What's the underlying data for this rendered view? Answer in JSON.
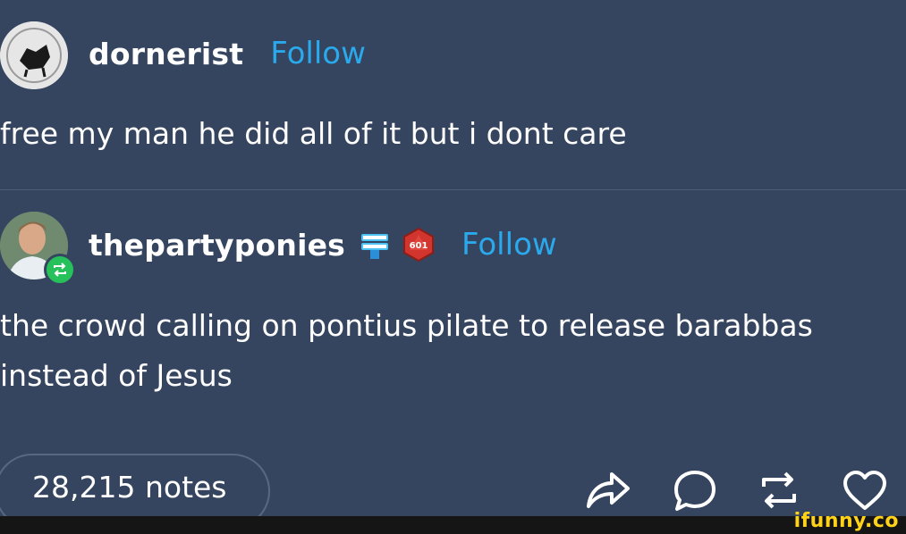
{
  "post1": {
    "username": "dornerist",
    "follow_label": "Follow",
    "text": "free my man he did all of it but i dont care"
  },
  "post2": {
    "username": "thepartyponies",
    "badge_number": "601",
    "follow_label": "Follow",
    "text_line1": "the crowd calling on pontius pilate to release barabbas",
    "text_line2": "instead of Jesus"
  },
  "footer": {
    "notes_label": "28,215 notes"
  },
  "watermark": "ifunny.co",
  "colors": {
    "background": "#36455f",
    "follow": "#2aa9ec",
    "reblog_badge": "#27c15b",
    "watermark": "#ffd21a"
  }
}
